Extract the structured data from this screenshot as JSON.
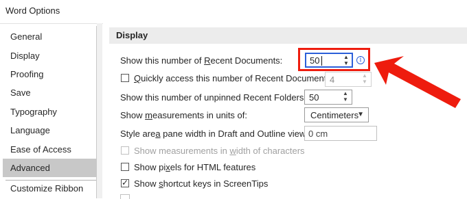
{
  "window": {
    "title": "Word Options"
  },
  "sidebar": {
    "items": [
      {
        "label": "General"
      },
      {
        "label": "Display"
      },
      {
        "label": "Proofing"
      },
      {
        "label": "Save"
      },
      {
        "label": "Typography"
      },
      {
        "label": "Language"
      },
      {
        "label": "Ease of Access"
      },
      {
        "label": "Advanced",
        "selected": true
      },
      {
        "label": "Customize Ribbon"
      }
    ]
  },
  "section": {
    "title": "Display"
  },
  "settings": {
    "recent_docs": {
      "label_before": "Show this number of ",
      "label_underline": "R",
      "label_after": "ecent Documents:",
      "value": "50"
    },
    "quick_access": {
      "label_before": "",
      "label_underline": "Q",
      "label_after": "uickly access this number of Recent Documents:",
      "checked": false,
      "value": "4"
    },
    "unpinned_folders": {
      "label": "Show this number of unpinned Recent Folders:",
      "value": "50"
    },
    "measurement_units": {
      "label_before": "Show ",
      "label_underline": "m",
      "label_after": "easurements in units of:",
      "value": "Centimeters"
    },
    "style_area": {
      "label_before": "Style are",
      "label_underline": "a",
      "label_after": " pane width in Draft and Outline views:",
      "value": "0 cm"
    },
    "width_chars": {
      "label_before": "Show measurements in ",
      "label_underline": "w",
      "label_after": "idth of characters",
      "checked": false
    },
    "pixels_html": {
      "label_before": "Show pi",
      "label_underline": "x",
      "label_after": "els for HTML features",
      "checked": false
    },
    "shortcut_keys": {
      "label_before": "Show ",
      "label_underline": "s",
      "label_after": "hortcut keys in ScreenTips",
      "checked": true
    }
  },
  "colors": {
    "highlight": "#ee1c0e",
    "focus": "#2b5fd9",
    "selected_nav": "#c8c8c8",
    "section_bg": "#ececec"
  },
  "icons": {
    "info": "info-icon",
    "spin_arrows": "spinner-arrows-icon",
    "dropdown": "chevron-down-icon",
    "annotation": "red-arrow-icon"
  }
}
